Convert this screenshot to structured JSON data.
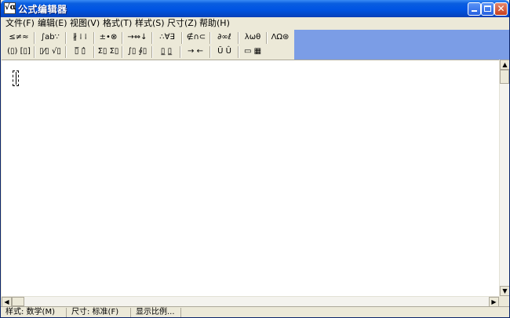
{
  "window": {
    "title": "公式编辑器",
    "icon_text": "√α"
  },
  "menu": [
    {
      "label": "文件(F)"
    },
    {
      "label": "编辑(E)"
    },
    {
      "label": "视图(V)"
    },
    {
      "label": "格式(T)"
    },
    {
      "label": "样式(S)"
    },
    {
      "label": "尺寸(Z)"
    },
    {
      "label": "帮助(H)"
    }
  ],
  "toolbar": {
    "row1": [
      {
        "label": "≤≠≈"
      },
      {
        "label": "∫ab∵"
      },
      {
        "label": "∦ ⁞ ⁞"
      },
      {
        "label": "±•⊗"
      },
      {
        "label": "→⇔↓"
      },
      {
        "label": "∴∀∃"
      },
      {
        "label": "∉∩⊂"
      },
      {
        "label": "∂∞ℓ"
      },
      {
        "label": "λωθ"
      },
      {
        "label": "ΛΩ⊛"
      }
    ],
    "row2": [
      {
        "label": "(▯) [▯]"
      },
      {
        "label": "▯⁄▯ √▯"
      },
      {
        "label": "▯̅ ▯̂"
      },
      {
        "label": "Σ▯ Σ▯"
      },
      {
        "label": "∫▯ ∮▯"
      },
      {
        "label": "▯̲ ▯̲"
      },
      {
        "label": "→ ←"
      },
      {
        "label": "Ū Û"
      },
      {
        "label": "▭ ▦"
      }
    ],
    "accent_color": "#7b9de6"
  },
  "status": {
    "style": "样式: 数学(M)",
    "size": "尺寸: 标准(F)",
    "zoom": "显示比例..."
  },
  "colors": {
    "titlebar": "#0054e3",
    "close_button": "#c7401e",
    "chrome": "#ece9d8"
  }
}
